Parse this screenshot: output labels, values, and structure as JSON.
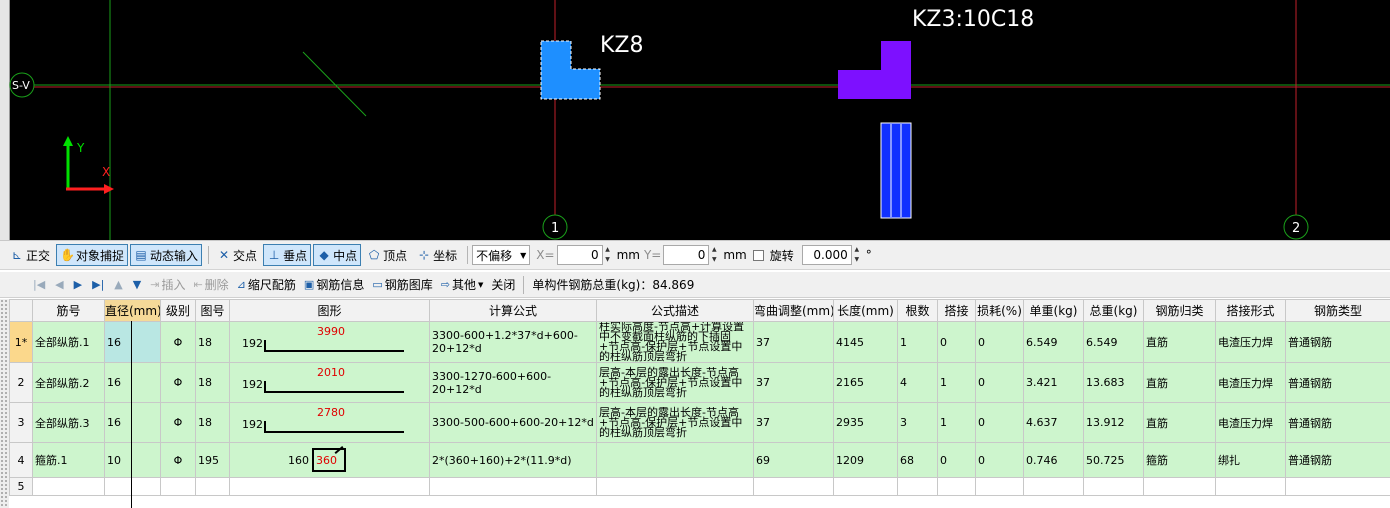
{
  "viewport": {
    "axis_label": "S-V",
    "column_left_label": "KZ8",
    "column_right_label": "KZ3:10C18",
    "grid_marker_1": "1",
    "grid_marker_2": "2",
    "ucs_y": "Y",
    "ucs_x": "X",
    "colors": {
      "background": "#000000",
      "grid_red": "#c0202a",
      "grid_green": "#1aa01a",
      "column_blue": "#1e8fff",
      "column_purple": "#7d10ff",
      "rebar_blue": "#1030ff"
    }
  },
  "snapbar": {
    "ortho": "正交",
    "object_snap": "对象捕捉",
    "dynamic_input": "动态输入",
    "intersection": "交点",
    "perpendicular": "垂点",
    "midpoint": "中点",
    "vertex": "顶点",
    "coordinate": "坐标",
    "offset_mode": "不偏移",
    "x_label": "X=",
    "x_value": "0",
    "x_unit": "mm",
    "y_label": "Y=",
    "y_value": "0",
    "y_unit": "mm",
    "rotate_label": "旋转",
    "rotate_value": "0.000",
    "degree": "°"
  },
  "rebarbar": {
    "insert": "插入",
    "delete": "删除",
    "scale_rebar": "缩尺配筋",
    "rebar_info": "钢筋信息",
    "rebar_library": "钢筋图库",
    "other": "其他",
    "close": "关闭",
    "total_weight": "单构件钢筋总重(kg)：84.869"
  },
  "table": {
    "headers": [
      "筋号",
      "直径(mm)",
      "级别",
      "图号",
      "图形",
      "计算公式",
      "公式描述",
      "弯曲调整(mm)",
      "长度(mm)",
      "根数",
      "搭接",
      "损耗(%)",
      "单重(kg)",
      "总重(kg)",
      "钢筋归类",
      "搭接形式",
      "钢筋类型"
    ],
    "rows": [
      {
        "num": "1*",
        "name": "全部纵筋.1",
        "diameter": "16",
        "grade": "Φ",
        "fig": "18",
        "shape_left": "192",
        "shape_val": "3990",
        "formula": "3300-600+1.2*37*d+600-20+12*d",
        "desc": "柱实际高度-节点高+计算设置中不变截面柱纵筋的下插固+节点高-保护层+节点设置中的柱纵筋顶层弯折",
        "bend": "37",
        "length": "4145",
        "count": "1",
        "lap": "0",
        "loss": "0",
        "unit_w": "6.549",
        "total_w": "6.549",
        "category": "直筋",
        "lap_type": "电渣压力焊",
        "rebar_type": "普通钢筋"
      },
      {
        "num": "2",
        "name": "全部纵筋.2",
        "diameter": "16",
        "grade": "Φ",
        "fig": "18",
        "shape_left": "192",
        "shape_val": "2010",
        "formula": "3300-1270-600+600-20+12*d",
        "desc": "层高-本层的露出长度-节点高+节点高-保护层+节点设置中的柱纵筋顶层弯折",
        "bend": "37",
        "length": "2165",
        "count": "4",
        "lap": "1",
        "loss": "0",
        "unit_w": "3.421",
        "total_w": "13.683",
        "category": "直筋",
        "lap_type": "电渣压力焊",
        "rebar_type": "普通钢筋"
      },
      {
        "num": "3",
        "name": "全部纵筋.3",
        "diameter": "16",
        "grade": "Φ",
        "fig": "18",
        "shape_left": "192",
        "shape_val": "2780",
        "formula": "3300-500-600+600-20+12*d",
        "desc": "层高-本层的露出长度-节点高+节点高-保护层+节点设置中的柱纵筋顶层弯折",
        "bend": "37",
        "length": "2935",
        "count": "3",
        "lap": "1",
        "loss": "0",
        "unit_w": "4.637",
        "total_w": "13.912",
        "category": "直筋",
        "lap_type": "电渣压力焊",
        "rebar_type": "普通钢筋"
      },
      {
        "num": "4",
        "name": "箍筋.1",
        "diameter": "10",
        "grade": "Φ",
        "fig": "195",
        "shape_left": "160",
        "shape_val": "360",
        "formula": "2*(360+160)+2*(11.9*d)",
        "desc": "",
        "bend": "69",
        "length": "1209",
        "count": "68",
        "lap": "0",
        "loss": "0",
        "unit_w": "0.746",
        "total_w": "50.725",
        "category": "箍筋",
        "lap_type": "绑扎",
        "rebar_type": "普通钢筋"
      }
    ],
    "empty_row_num": "5"
  }
}
